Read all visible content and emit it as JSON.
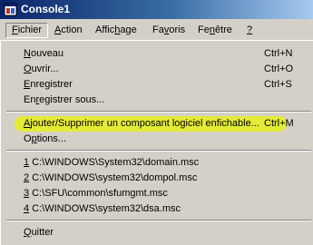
{
  "window": {
    "title": "Console1"
  },
  "menubar": {
    "items": [
      {
        "label": "Fichier",
        "accel": "F"
      },
      {
        "label": "Action",
        "accel": "A"
      },
      {
        "label": "Affichage",
        "accel": "h"
      },
      {
        "label": "Favoris",
        "accel": "v"
      },
      {
        "label": "Fenêtre",
        "accel": "n"
      },
      {
        "label": "?",
        "accel": "?"
      }
    ],
    "active_index": 0
  },
  "file_menu": {
    "items": [
      {
        "label": "Nouveau",
        "shortcut": "Ctrl+N"
      },
      {
        "label": "Ouvrir...",
        "shortcut": "Ctrl+O"
      },
      {
        "label": "Enregistrer",
        "shortcut": "Ctrl+S"
      },
      {
        "label": "Enregistrer sous...",
        "shortcut": ""
      },
      {
        "label": "Ajouter/Supprimer un composant logiciel enfichable...",
        "shortcut": "Ctrl+M"
      },
      {
        "label": "Options...",
        "shortcut": ""
      },
      {
        "label": "1 C:\\WINDOWS\\System32\\domain.msc",
        "shortcut": ""
      },
      {
        "label": "2 C:\\WINDOWS\\system32\\dompol.msc",
        "shortcut": ""
      },
      {
        "label": "3 C:\\SFU\\common\\sfumgmt.msc",
        "shortcut": ""
      },
      {
        "label": "4 C:\\WINDOWS\\system32\\dsa.msc",
        "shortcut": ""
      },
      {
        "label": "Quitter",
        "shortcut": ""
      }
    ]
  },
  "colors": {
    "highlight": "#e4ec2e",
    "titlebar_start": "#0a246a",
    "titlebar_end": "#a6caf0",
    "face": "#d4d0c8"
  }
}
